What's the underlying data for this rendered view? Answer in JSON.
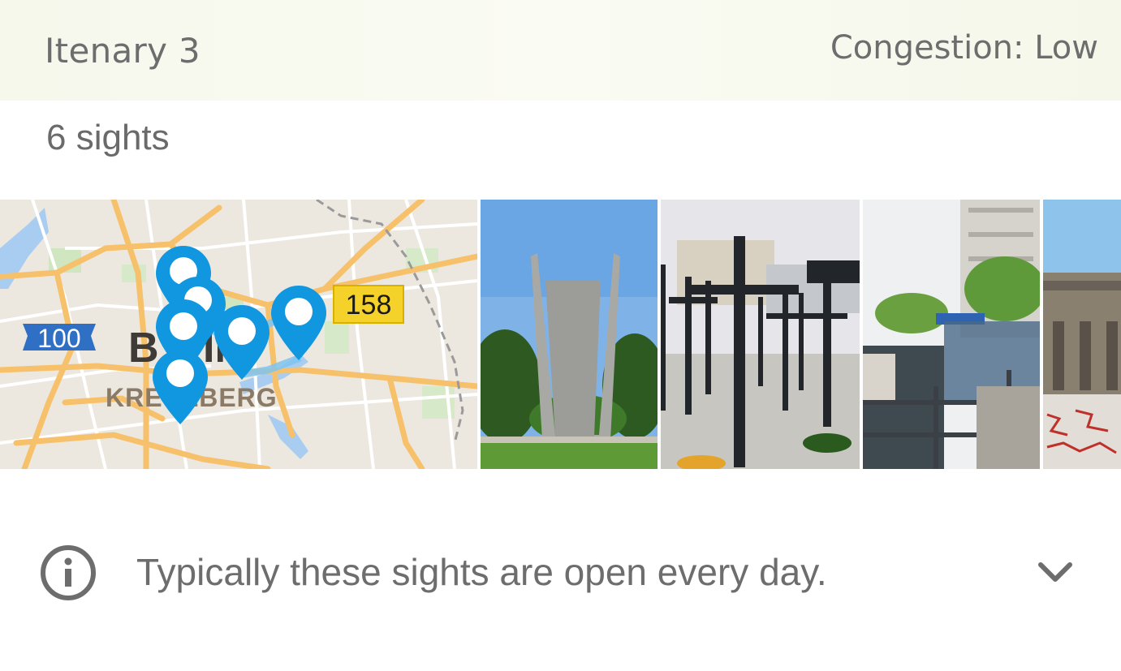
{
  "header": {
    "title": "Itenary 3",
    "congestion": "Congestion: Low"
  },
  "summary": {
    "sight_count": "6 sights"
  },
  "map": {
    "shield_highway": "100",
    "shield_route": "158",
    "district": "KREUZBERG",
    "city": "BERLIN",
    "marker_color": "#1196e0"
  },
  "photos": [
    {
      "name": "airlift-memorial"
    },
    {
      "name": "crosses-memorial"
    },
    {
      "name": "riverside-pier"
    },
    {
      "name": "brandenburg-gate-wall"
    }
  ],
  "info": {
    "icon": "info-icon",
    "text": "Typically these sights are open every day.",
    "expand_icon": "chevron-down-icon"
  }
}
